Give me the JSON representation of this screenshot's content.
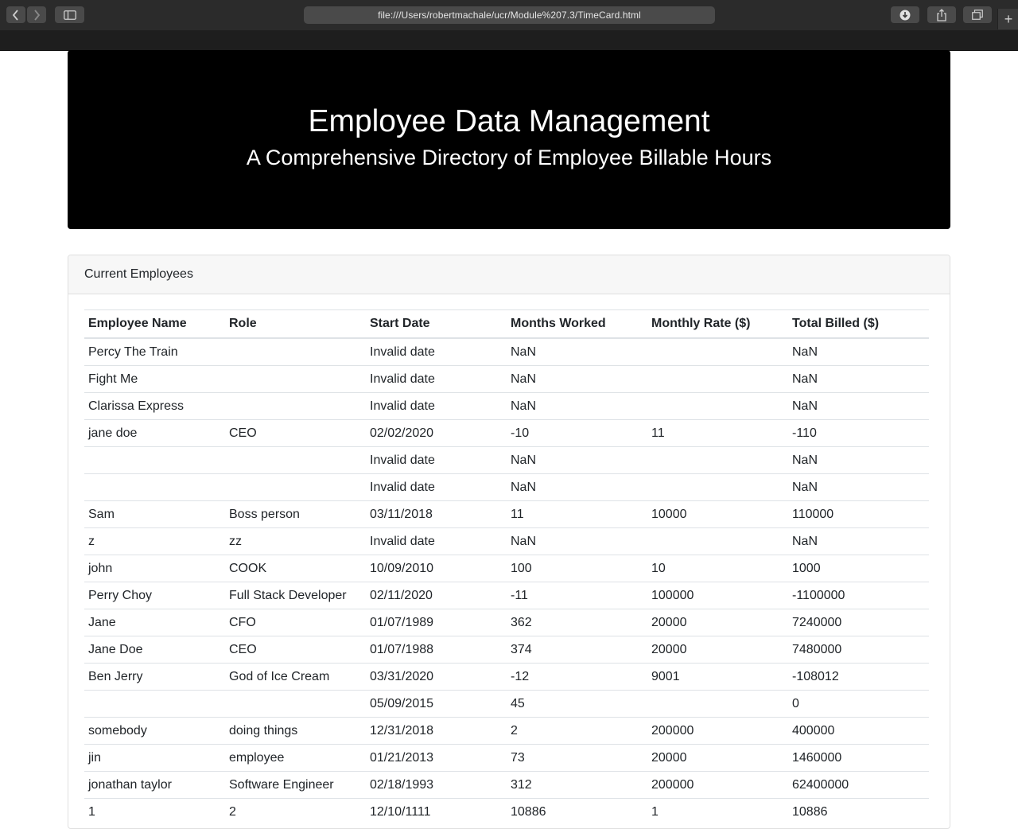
{
  "browser": {
    "url": "file:///Users/robertmachale/ucr/Module%207.3/TimeCard.html",
    "icons": [
      "back-icon",
      "forward-icon",
      "sidebar-icon",
      "download-icon",
      "share-icon",
      "tabs-overview-icon",
      "plus-icon"
    ]
  },
  "header": {
    "title": "Employee Data Management",
    "subtitle": "A Comprehensive Directory of Employee Billable Hours"
  },
  "card": {
    "title": "Current Employees"
  },
  "table": {
    "columns": [
      "Employee Name",
      "Role",
      "Start Date",
      "Months Worked",
      "Monthly Rate ($)",
      "Total Billed ($)"
    ],
    "rows": [
      [
        "Percy The Train",
        "",
        "Invalid date",
        "NaN",
        "",
        "NaN"
      ],
      [
        "Fight Me",
        "",
        "Invalid date",
        "NaN",
        "",
        "NaN"
      ],
      [
        "Clarissa Express",
        "",
        "Invalid date",
        "NaN",
        "",
        "NaN"
      ],
      [
        "jane doe",
        "CEO",
        "02/02/2020",
        "-10",
        "11",
        "-110"
      ],
      [
        "",
        "",
        "Invalid date",
        "NaN",
        "",
        "NaN"
      ],
      [
        "",
        "",
        "Invalid date",
        "NaN",
        "",
        "NaN"
      ],
      [
        "Sam",
        "Boss person",
        "03/11/2018",
        "11",
        "10000",
        "110000"
      ],
      [
        "z",
        "zz",
        "Invalid date",
        "NaN",
        "",
        "NaN"
      ],
      [
        "john",
        "COOK",
        "10/09/2010",
        "100",
        "10",
        "1000"
      ],
      [
        "Perry Choy",
        "Full Stack Developer",
        "02/11/2020",
        "-11",
        "100000",
        "-1100000"
      ],
      [
        "Jane",
        "CFO",
        "01/07/1989",
        "362",
        "20000",
        "7240000"
      ],
      [
        "Jane Doe",
        "CEO",
        "01/07/1988",
        "374",
        "20000",
        "7480000"
      ],
      [
        "Ben Jerry",
        "God of Ice Cream",
        "03/31/2020",
        "-12",
        "9001",
        "-108012"
      ],
      [
        "",
        "",
        "05/09/2015",
        "45",
        "",
        "0"
      ],
      [
        "somebody",
        "doing things",
        "12/31/2018",
        "2",
        "200000",
        "400000"
      ],
      [
        "jin",
        "employee",
        "01/21/2013",
        "73",
        "20000",
        "1460000"
      ],
      [
        "jonathan taylor",
        "Software Engineer",
        "02/18/1993",
        "312",
        "200000",
        "62400000"
      ],
      [
        "1",
        "2",
        "12/10/1111",
        "10886",
        "1",
        "10886"
      ]
    ]
  }
}
